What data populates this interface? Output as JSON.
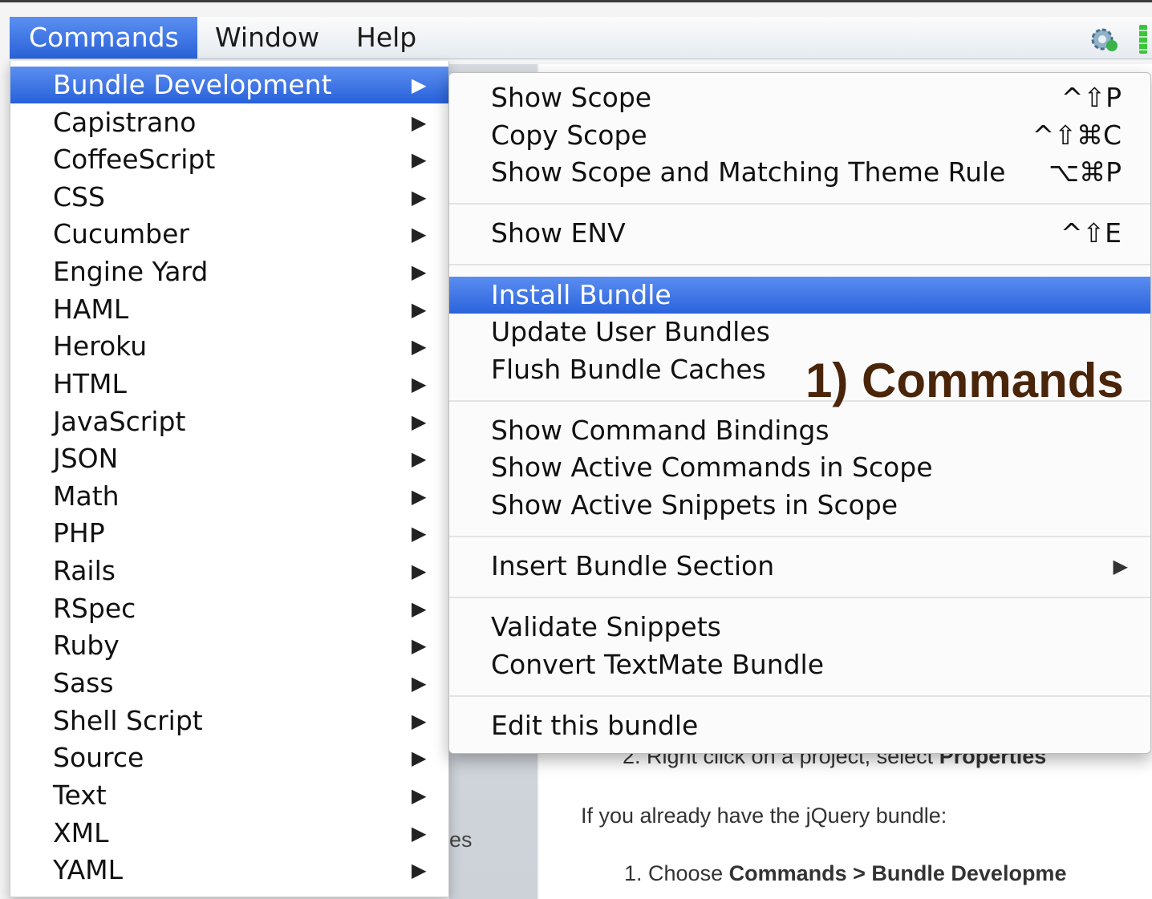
{
  "menubar": {
    "items": [
      "Commands",
      "Window",
      "Help"
    ],
    "active_index": 0
  },
  "main_menu": {
    "items": [
      "Bundle Development",
      "Capistrano",
      "CoffeeScript",
      "CSS",
      "Cucumber",
      "Engine Yard",
      "HAML",
      "Heroku",
      "HTML",
      "JavaScript",
      "JSON",
      "Math",
      "PHP",
      "Rails",
      "RSpec",
      "Ruby",
      "Sass",
      "Shell Script",
      "Source",
      "Text",
      "XML",
      "YAML"
    ],
    "highlighted": "Bundle Development",
    "submenu_arrow": "▶"
  },
  "submenu": {
    "show_scope": {
      "label": "Show Scope",
      "shortcut": "^⇧P"
    },
    "copy_scope": {
      "label": "Copy Scope",
      "shortcut": "^⇧⌘C"
    },
    "show_scope_theme": {
      "label": "Show Scope and Matching Theme Rule",
      "shortcut": "⌥⌘P"
    },
    "show_env": {
      "label": "Show ENV",
      "shortcut": "^⇧E"
    },
    "install_bundle": {
      "label": "Install Bundle"
    },
    "update_user_bundles": {
      "label": "Update User Bundles"
    },
    "flush_bundle_caches": {
      "label": "Flush Bundle Caches"
    },
    "show_command_bindings": {
      "label": "Show Command Bindings"
    },
    "show_active_commands": {
      "label": "Show Active Commands in Scope"
    },
    "show_active_snippets": {
      "label": "Show Active Snippets in Scope"
    },
    "insert_bundle_section": {
      "label": "Insert Bundle Section"
    },
    "validate_snippets": {
      "label": "Validate Snippets"
    },
    "convert_textmate_bundle": {
      "label": "Convert TextMate Bundle"
    },
    "edit_this_bundle": {
      "label": "Edit this bundle"
    }
  },
  "annotation": "1) Commands",
  "background": {
    "step2": "2.  Right click on a project, select",
    "step2_bold": "Properties",
    "jquery_note": "If you already have the jQuery bundle:",
    "step1": "1.  Choose",
    "step1_bold": "Commands > Bundle Developme",
    "sidepane_fragment": "es"
  },
  "colors": {
    "highlight": "#2a63dc",
    "annotation": "#4a2509"
  }
}
